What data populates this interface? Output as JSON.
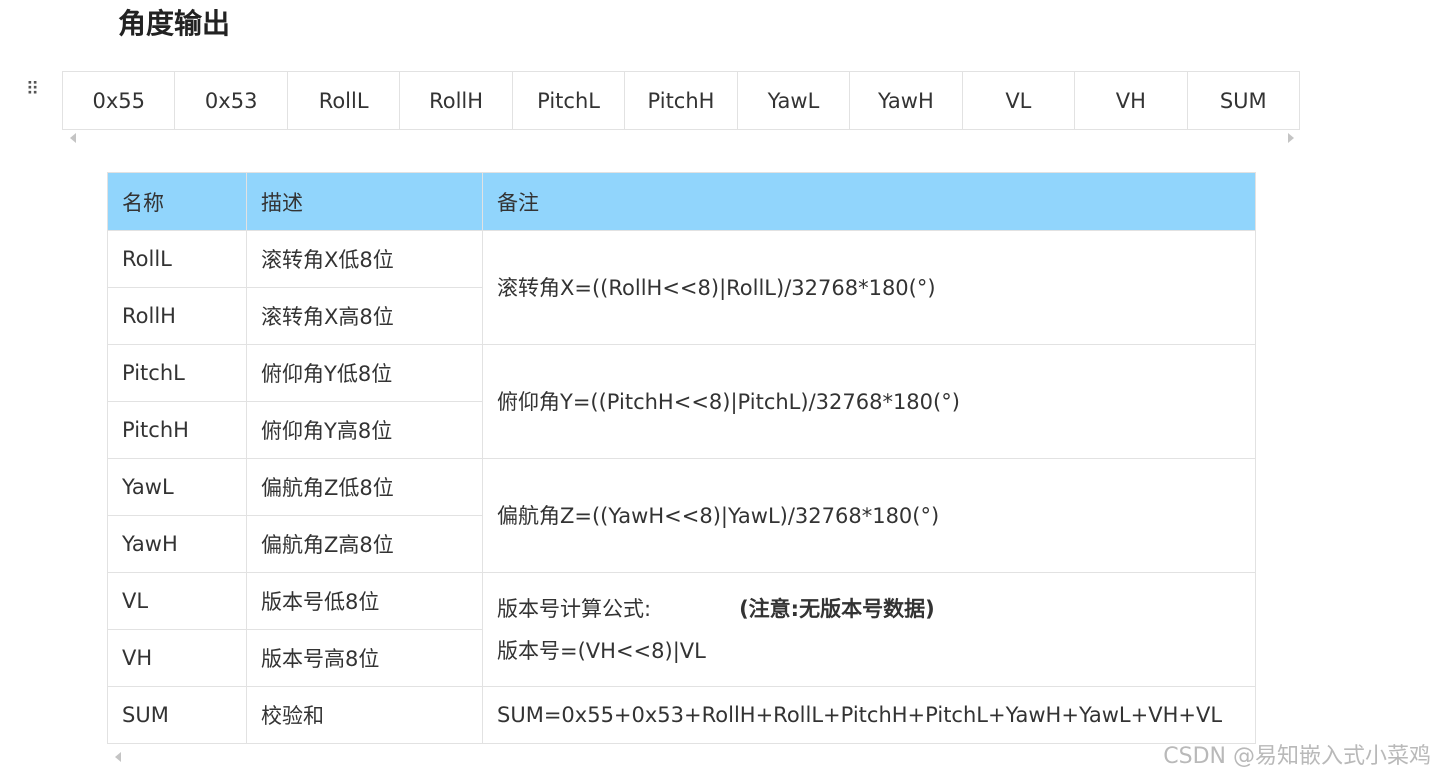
{
  "heading": "角度输出",
  "byte_order": [
    "0x55",
    "0x53",
    "RollL",
    "RollH",
    "PitchL",
    "PitchH",
    "YawL",
    "YawH",
    "VL",
    "VH",
    "SUM"
  ],
  "table": {
    "headers": [
      "名称",
      "描述",
      "备注"
    ],
    "header_color": "#91d5fc",
    "rows": [
      {
        "name": "RollL",
        "desc": "滚转角X低8位"
      },
      {
        "name": "RollH",
        "desc": "滚转角X高8位"
      },
      {
        "name": "PitchL",
        "desc": "俯仰角Y低8位"
      },
      {
        "name": "PitchH",
        "desc": "俯仰角Y高8位"
      },
      {
        "name": "YawL",
        "desc": "偏航角Z低8位"
      },
      {
        "name": "YawH",
        "desc": "偏航角Z高8位"
      },
      {
        "name": "VL",
        "desc": "版本号低8位"
      },
      {
        "name": "VH",
        "desc": "版本号高8位"
      },
      {
        "name": "SUM",
        "desc": "校验和"
      }
    ],
    "notes": {
      "roll": "滚转角X=((RollH<<8)|RollL)/32768*180(°)",
      "pitch": "俯仰角Y=((PitchH<<8)|PitchL)/32768*180(°)",
      "yaw": "偏航角Z=((YawH<<8)|YawL)/32768*180(°)",
      "version_formula_label": "版本号计算公式:",
      "version_warning": "(注意:无版本号数据)",
      "version_formula": "版本号=(VH<<8)|VL",
      "sum": "SUM=0x55+0x53+RollH+RollL+PitchH+PitchL+YawH+YawL+VH+VL"
    }
  },
  "watermark": "CSDN @易知嵌入式小菜鸡"
}
